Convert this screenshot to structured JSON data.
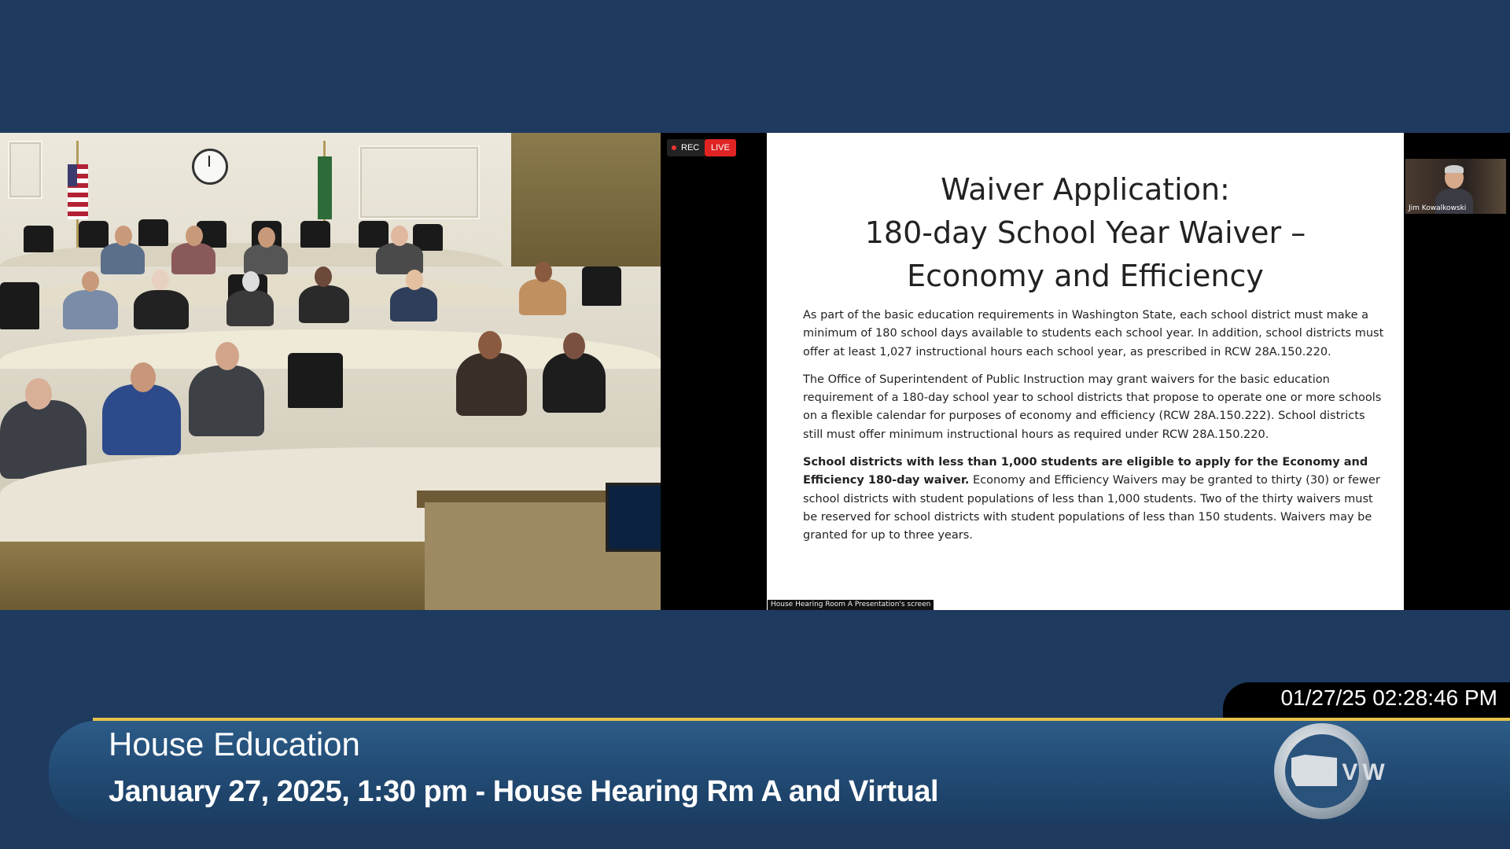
{
  "zoom": {
    "rec_label": "REC",
    "live_label": "LIVE",
    "screen_share_label": "House Hearing Room A Presentation's screen",
    "participant_name": "Jim Kowalkowski",
    "colors": {
      "live": "#e02424",
      "rec_dot": "#e33333"
    }
  },
  "slide": {
    "title_lines": [
      "Waiver Application:",
      "180-day School Year Waiver –",
      "Economy and Efficiency"
    ],
    "p1": "As part of the basic education requirements in Washington State, each school district must make a minimum of 180 school days available to students each school year. In addition, school districts must offer at least 1,027 instructional hours each school year, as prescribed in RCW 28A.150.220.",
    "p2": "The Office of Superintendent of Public Instruction may grant waivers for the basic education requirement of a 180-day school year to school districts that propose to operate one or more schools on a flexible calendar for purposes of economy and efficiency (RCW 28A.150.222). School districts still must offer minimum instructional hours as required under RCW 28A.150.220.",
    "p3_bold": "School districts with less than 1,000 students are eligible to apply for the Economy and Efficiency 180-day waiver.",
    "p3_rest": " Economy and Efficiency Waivers may be granted to thirty (30) or fewer school districts with student populations of less than 1,000 students.  Two of the thirty waivers must be reserved for school districts with student populations of less than 150 students. Waivers may be granted for up to three years."
  },
  "broadcast": {
    "timestamp": "01/27/25 02:28:46 PM",
    "title": "House Education",
    "subtitle": "January 27, 2025, 1:30 pm - House Hearing Rm A and Virtual",
    "logo_text": "TVW",
    "colors": {
      "background": "#1f3a5f",
      "accent_line": "#e6c24a",
      "banner": "#224b74"
    }
  }
}
